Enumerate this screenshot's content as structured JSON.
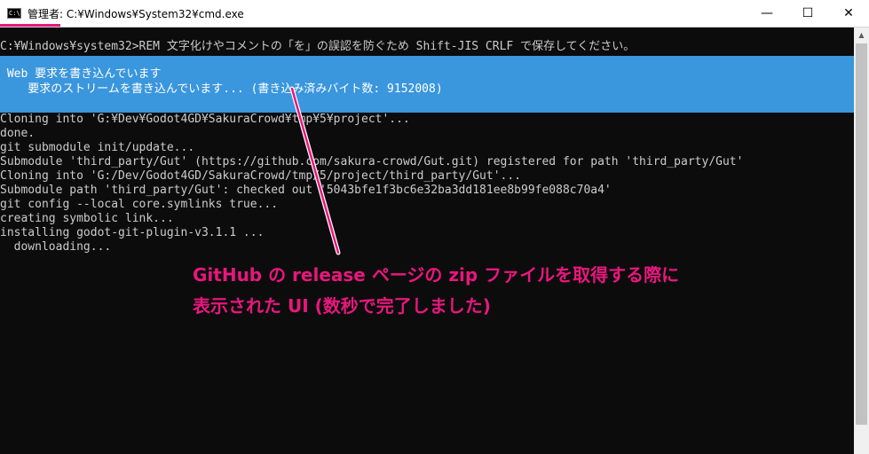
{
  "window": {
    "title": "管理者: C:¥Windows¥System32¥cmd.exe",
    "icon_label": "C:\\",
    "minimize_glyph": "—",
    "maximize_glyph": "☐",
    "close_glyph": "✕"
  },
  "console": {
    "prompt_line": "C:¥Windows¥system32>REM 文字化けやコメントの「を」の誤認を防ぐため Shift-JIS CRLF で保存してください。",
    "progress": {
      "line1": " Web 要求を書き込んでいます",
      "line2": "    要求のストリームを書き込んでいます... (書き込み済みバイト数: 9152008)"
    },
    "lines": [
      "Cloning into 'G:¥Dev¥Godot4GD¥SakuraCrowd¥tmp¥5¥project'...",
      "done.",
      "git submodule init/update...",
      "Submodule 'third_party/Gut' (https://github.com/sakura-crowd/Gut.git) registered for path 'third_party/Gut'",
      "Cloning into 'G:/Dev/Godot4GD/SakuraCrowd/tmp/5/project/third_party/Gut'...",
      "Submodule path 'third_party/Gut': checked out '5043bfe1f3bc6e32ba3dd181ee8b99fe088c70a4'",
      "git config --local core.symlinks true...",
      "creating symbolic link...",
      "installing godot-git-plugin-v3.1.1 ...",
      "  downloading..."
    ]
  },
  "annotation": {
    "line1": "GitHub の release ページの zip ファイルを取得する際に",
    "line2": "表示された UI (数秒で完了しました)",
    "color": "#e8177d"
  },
  "colors": {
    "console_bg": "#0c0c0c",
    "console_text": "#cccccc",
    "progress_bg": "#3a96dd"
  }
}
